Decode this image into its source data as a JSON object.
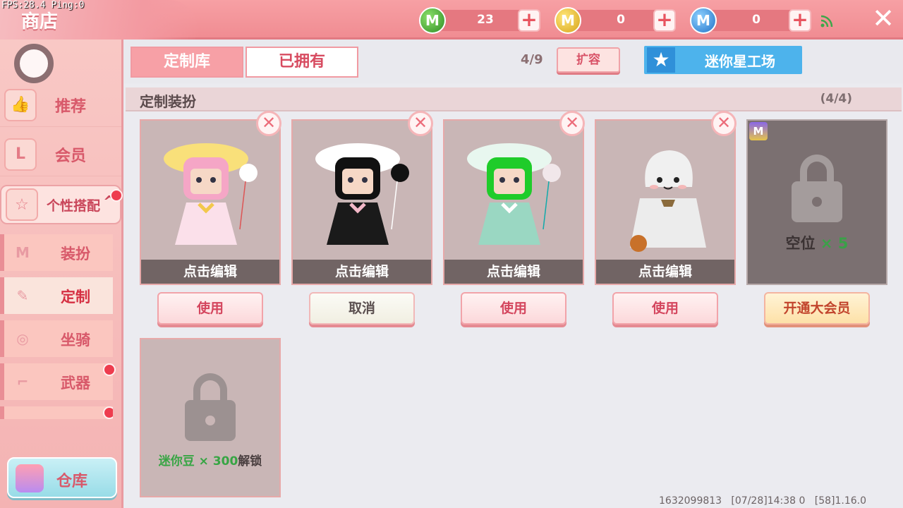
{
  "debug": {
    "fps": "FPS:28.4  Ping:0"
  },
  "header": {
    "title": "商店",
    "currencies": [
      {
        "name": "green-gem",
        "value": "23",
        "color": "#3f9a2e"
      },
      {
        "name": "gold-coin",
        "value": "0",
        "color": "#e0b020"
      },
      {
        "name": "mini-bean",
        "value": "0",
        "color": "#2f86d8"
      }
    ],
    "close_icon": "close-icon"
  },
  "sidebar": {
    "items": [
      {
        "label": "推荐",
        "icon": "thumbs-up-icon"
      },
      {
        "label": "会员",
        "icon": "vip-card-icon"
      },
      {
        "label": "个性搭配",
        "icon": "badge-icon",
        "expanded": true
      }
    ],
    "sub_items": [
      {
        "label": "装扮",
        "icon": "shirt-icon"
      },
      {
        "label": "定制",
        "icon": "brush-icon",
        "active": true
      },
      {
        "label": "坐骑",
        "icon": "stroller-icon"
      },
      {
        "label": "武器",
        "icon": "gun-icon"
      }
    ],
    "warehouse_label": "仓库"
  },
  "tabs": {
    "library": "定制库",
    "owned": "已拥有"
  },
  "toolbar": {
    "capacity": "4/9",
    "expand_label": "扩容",
    "workshop_label": "迷你星工场"
  },
  "section": {
    "title": "定制装扮",
    "count": "(4/4)"
  },
  "outfits": [
    {
      "edit_label": "点击编辑",
      "action": "使用",
      "hair": "#f5a6c6",
      "hat": "#f9e07a",
      "dress": "#fbe0ea"
    },
    {
      "edit_label": "点击编辑",
      "action": "取消",
      "hair": "#111111",
      "hat": "#ffffff",
      "dress": "#1a1a1a"
    },
    {
      "edit_label": "点击编辑",
      "action": "使用",
      "hair": "#1fcc2a",
      "hat": "#e8f7ef",
      "dress": "#9ad7c2"
    },
    {
      "edit_label": "点击编辑",
      "action": "使用",
      "hair": "#f0f0f0",
      "hat": "#f0f0f0",
      "dress": "#ececec"
    }
  ],
  "vip_slot": {
    "badge": "M",
    "text": "空位",
    "multiplier": "× 5",
    "action": "开通大会员"
  },
  "locked_slot": {
    "currency": "迷你豆",
    "amount": "× 300",
    "suffix": "解锁"
  },
  "footer": {
    "info": "1632099813   [07/28]14:38 0   [58]1.16.0"
  }
}
